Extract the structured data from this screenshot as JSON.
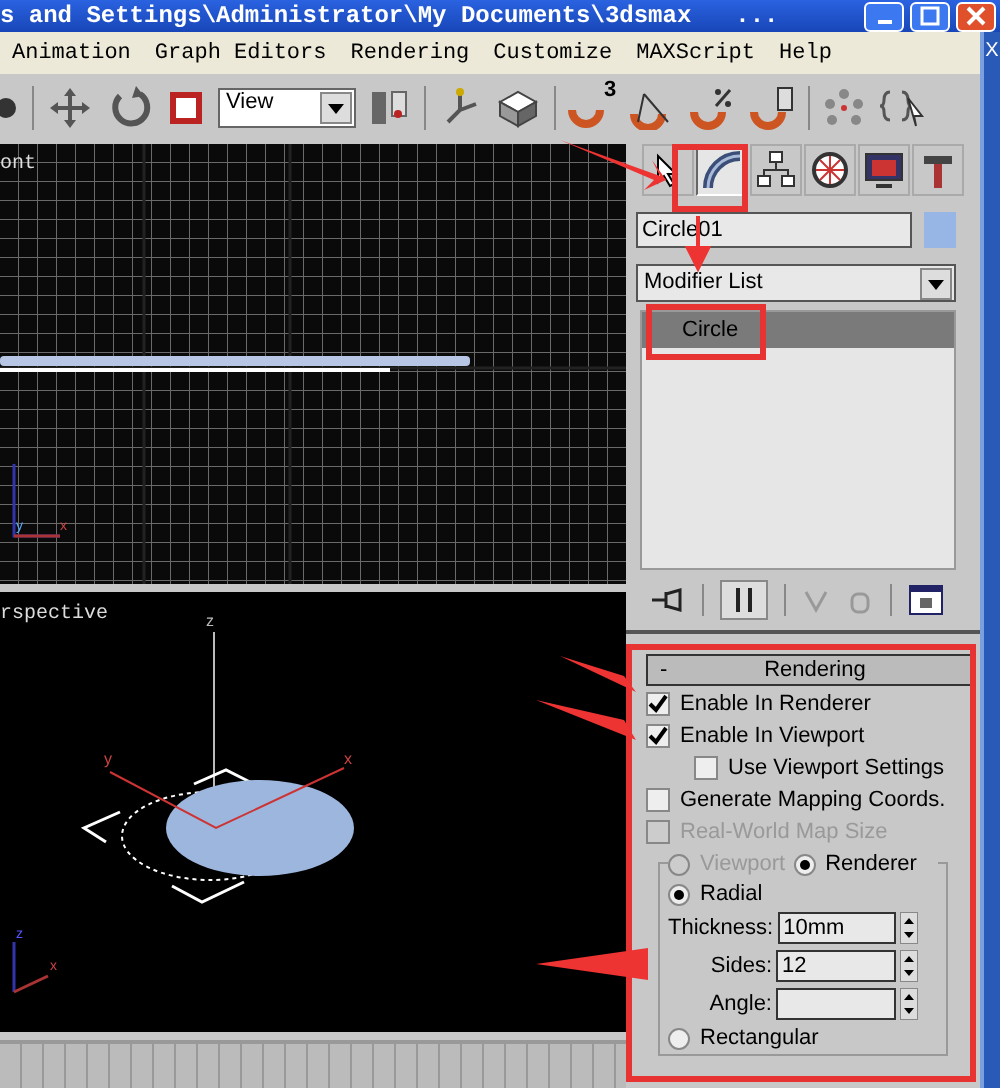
{
  "window": {
    "title": "s and Settings\\Administrator\\My Documents\\3dsmax",
    "title_more": "..."
  },
  "menu": [
    "Animation",
    "Graph Editors",
    "Rendering",
    "Customize",
    "MAXScript",
    "Help"
  ],
  "toolbar": {
    "reference_dropdown": "View",
    "snap_mode": "3"
  },
  "viewports": [
    {
      "kind": "front",
      "label": "ont",
      "axis_labels": [
        "y",
        "x"
      ]
    },
    {
      "kind": "perspective",
      "label": "rspective",
      "gizmo_labels": [
        "z",
        "y",
        "x"
      ],
      "axis_labels": [
        "z",
        "x"
      ]
    }
  ],
  "command_panel": {
    "tabs": [
      {
        "selected": false
      },
      {
        "selected": true
      },
      {
        "selected": false
      },
      {
        "selected": false
      },
      {
        "selected": false
      },
      {
        "selected": false
      }
    ],
    "object_name": "Circle01",
    "modifier_list": "Modifier List",
    "stack": [
      {
        "label": "Circle",
        "selected": true
      }
    ],
    "rollout": {
      "toggle": "-",
      "title": "Rendering",
      "options": [
        {
          "label": "Enable In Renderer",
          "checked": true,
          "disabled": false
        },
        {
          "label": "Enable In Viewport",
          "checked": true,
          "disabled": false,
          "children": [
            {
              "label": "Use Viewport Settings",
              "checked": false,
              "disabled": false
            }
          ]
        },
        {
          "label": "Generate Mapping Coords.",
          "checked": false,
          "disabled": false
        },
        {
          "label": "Real-World Map Size",
          "checked": false,
          "disabled": true
        }
      ],
      "source": [
        {
          "label": "Viewport",
          "selected": false,
          "disabled": true
        },
        {
          "label": "Renderer",
          "selected": true,
          "disabled": false
        }
      ],
      "profiles": [
        {
          "label": "Radial",
          "selected": true,
          "params": [
            {
              "label": "Thickness:",
              "value": "10mm"
            },
            {
              "label": "Sides:",
              "value": "12"
            },
            {
              "label": "Angle:"
            }
          ]
        },
        {
          "label": "Rectangular",
          "selected": false
        }
      ]
    }
  },
  "desktop_edge": [
    "X"
  ]
}
